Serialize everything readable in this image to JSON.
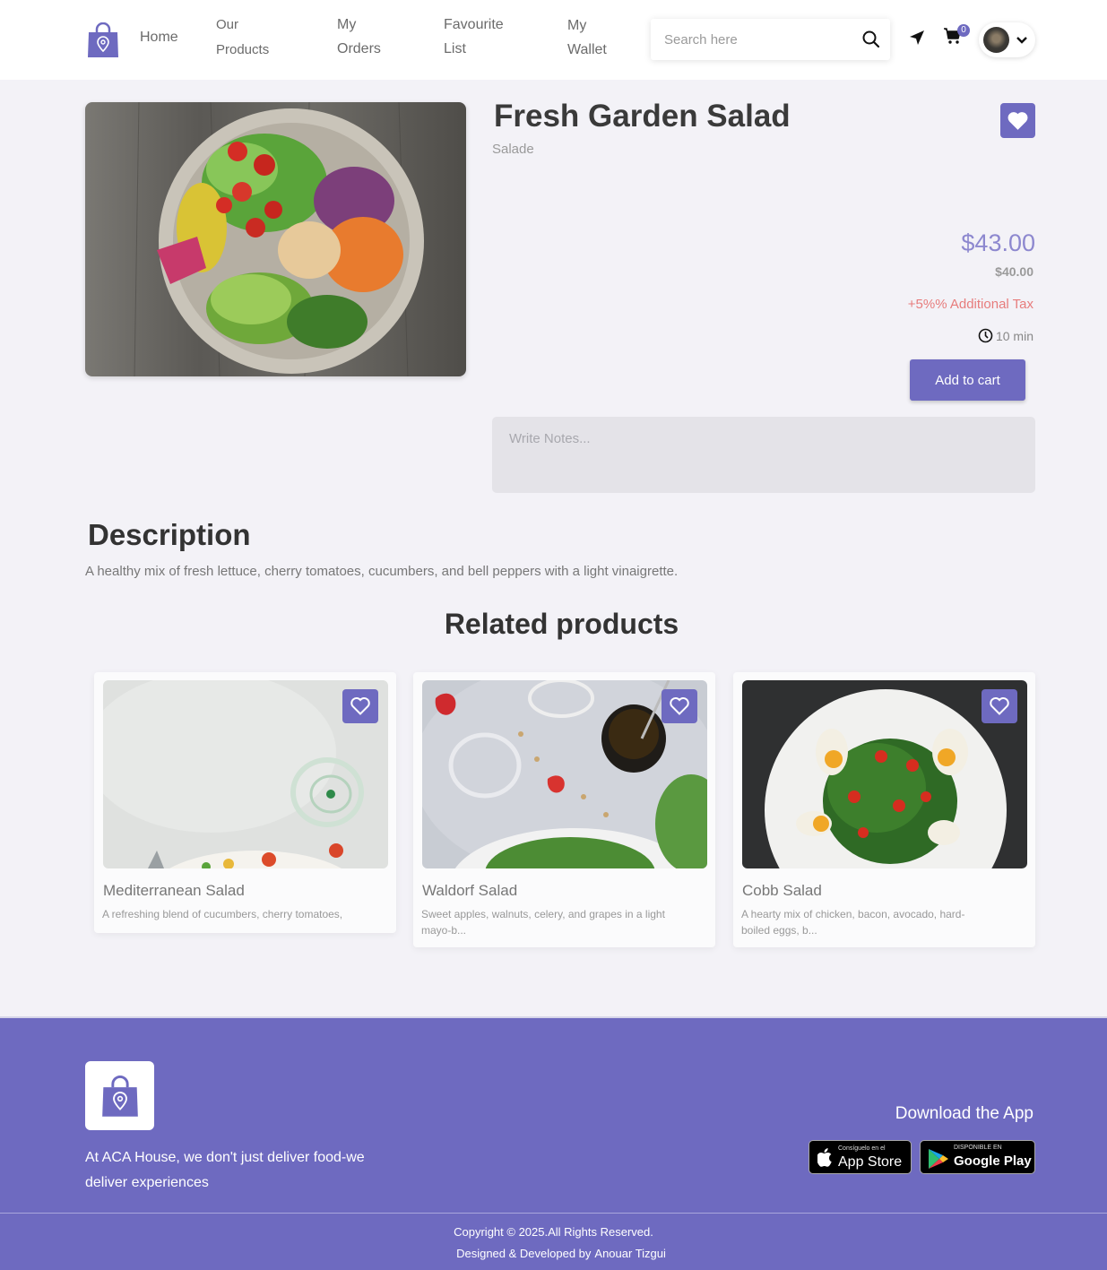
{
  "nav": {
    "home": "Home",
    "products_line1": "Our",
    "products_line2": "Products",
    "orders_line1": "My",
    "orders_line2": "Orders",
    "fav_line1": "Favourite",
    "fav_line2": "List",
    "wallet_line1": "My",
    "wallet_line2": "Wallet",
    "search_placeholder": "Search here",
    "cart_count": "0"
  },
  "product": {
    "title": "Fresh Garden Salad",
    "category": "Salade",
    "price": "$43.00",
    "old_price": "$40.00",
    "tax": "+5%% Additional Tax",
    "time": "10 min",
    "add_to_cart": "Add to cart",
    "notes_placeholder": "Write Notes..."
  },
  "description": {
    "title": "Description",
    "text": "A healthy mix of fresh lettuce, cherry tomatoes, cucumbers, and bell peppers with a light vinaigrette."
  },
  "related": {
    "title": "Related products",
    "items": [
      {
        "name": "Mediterranean Salad",
        "desc": "A refreshing blend of cucumbers, cherry tomatoes,"
      },
      {
        "name": "Waldorf Salad",
        "desc": "Sweet apples, walnuts, celery, and grapes in a light mayo-b..."
      },
      {
        "name": "Cobb Salad",
        "desc": "A hearty mix of chicken, bacon, avocado, hard-boiled eggs, b..."
      }
    ]
  },
  "footer": {
    "tagline": "At ACA House, we don't just deliver food-we deliver experiences",
    "download_title": "Download the App",
    "app_store_small": "Consíguelo en el",
    "app_store_big": "App Store",
    "google_small": "DISPONIBLE EN",
    "google_big": "Google Play",
    "copyright": "Copyright © 2025.All Rights Reserved.",
    "designed_by": "Designed & Developed by",
    "author": "Anouar Tizgui"
  },
  "colors": {
    "accent": "#6e6ac0",
    "price": "#8d88cf",
    "tax": "#e77c7c",
    "background": "#f3f2f7"
  }
}
